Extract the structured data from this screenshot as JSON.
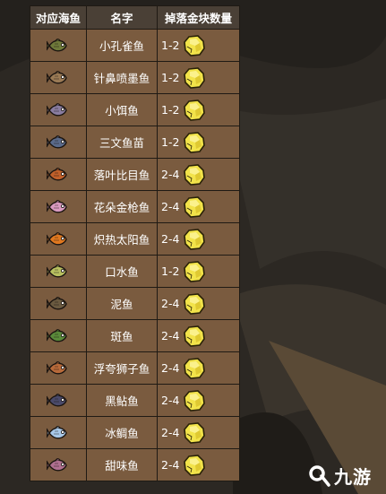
{
  "table": {
    "headers": [
      "对应海鱼",
      "名字",
      "掉落金块数量"
    ],
    "rows": [
      {
        "name": "小孔雀鱼",
        "count": "1-2",
        "fish_icon": "small-peacock-fish-icon",
        "color": "#6f7a3a"
      },
      {
        "name": "针鼻喷墨鱼",
        "count": "1-2",
        "fish_icon": "needlenose-squirt-fish-icon",
        "color": "#9a7a55"
      },
      {
        "name": "小饵鱼",
        "count": "1-2",
        "fish_icon": "bait-fish-icon",
        "color": "#8a7da0"
      },
      {
        "name": "三文鱼苗",
        "count": "1-2",
        "fish_icon": "salmon-fry-icon",
        "color": "#5a6a8a"
      },
      {
        "name": "落叶比目鱼",
        "count": "2-4",
        "fish_icon": "fallen-leaf-flounder-icon",
        "color": "#c0602a"
      },
      {
        "name": "花朵金枪鱼",
        "count": "2-4",
        "fish_icon": "flower-tuna-icon",
        "color": "#d99ac0"
      },
      {
        "name": "炽热太阳鱼",
        "count": "2-4",
        "fish_icon": "hot-sunfish-icon",
        "color": "#e07820"
      },
      {
        "name": "口水鱼",
        "count": "1-2",
        "fish_icon": "spittlefish-icon",
        "color": "#b8c060"
      },
      {
        "name": "泥鱼",
        "count": "2-4",
        "fish_icon": "mudfish-icon",
        "color": "#6a5a40"
      },
      {
        "name": "斑鱼",
        "count": "2-4",
        "fish_icon": "spotted-fish-icon",
        "color": "#5a8a3a"
      },
      {
        "name": "浮夸狮子鱼",
        "count": "2-4",
        "fish_icon": "flashy-lionfish-icon",
        "color": "#b86a3a"
      },
      {
        "name": "黑鲇鱼",
        "count": "2-4",
        "fish_icon": "black-catfish-icon",
        "color": "#4a4a6a"
      },
      {
        "name": "冰鲷鱼",
        "count": "2-4",
        "fish_icon": "ice-bream-icon",
        "color": "#a8c8e8"
      },
      {
        "name": "甜味鱼",
        "count": "2-4",
        "fish_icon": "sweetish-fish-icon",
        "color": "#b07090"
      }
    ],
    "gold_icon": "gold-nugget-icon",
    "gold_color": "#f2e34a"
  },
  "watermark": {
    "text": "九游",
    "icon": "9you-logo-icon"
  }
}
